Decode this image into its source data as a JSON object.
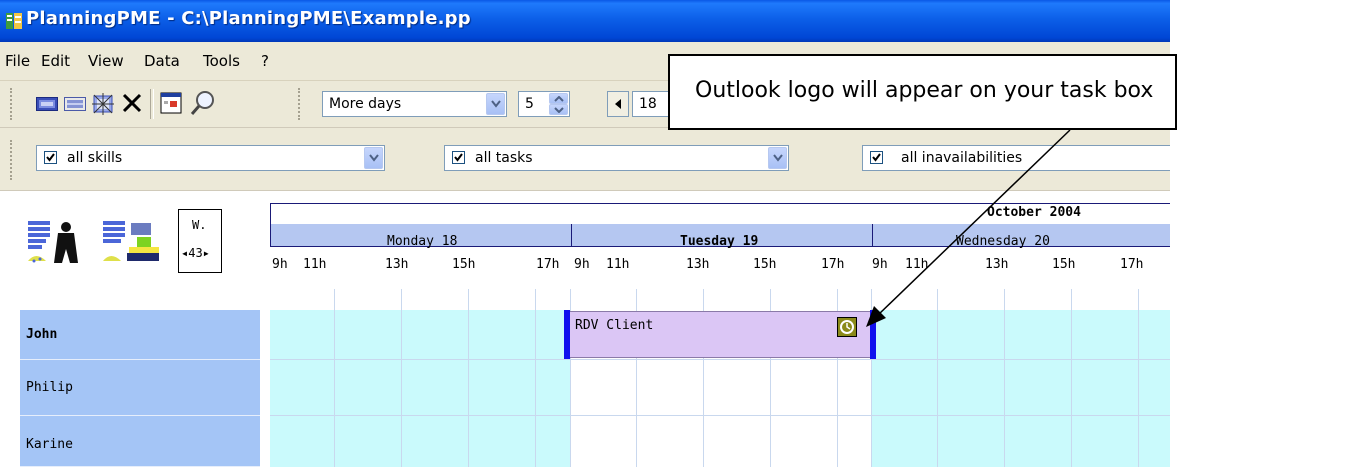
{
  "window": {
    "title": "PlanningPME - C:\\PlanningPME\\Example.pp",
    "title_bar_color": "#0054e3"
  },
  "menu": {
    "items": [
      "File",
      "Edit",
      "View",
      "Data",
      "Tools",
      "?"
    ]
  },
  "toolbar1": {
    "buttons": [
      "view-week-icon",
      "view-day-icon",
      "snowflake-icon",
      "delete-icon",
      "calendar-icon",
      "zoom-icon"
    ],
    "period_select": "More days",
    "count_value": "5",
    "date_partial": "18"
  },
  "filters": {
    "skills": "all skills",
    "tasks": "all tasks",
    "inavailabilities": "all inavailabilities"
  },
  "planning": {
    "week_box": {
      "top": "W.",
      "bottom": "◂43▸"
    },
    "month": "October 2004",
    "days": [
      "Monday 18",
      "Tuesday 19",
      "Wednesday 20"
    ],
    "hours": [
      "9h",
      "11h",
      "13h",
      "15h",
      "17h"
    ],
    "resources": [
      "John",
      "Philip",
      "Karine"
    ],
    "task": {
      "label": "RDV Client",
      "color": "#dbc6f5"
    }
  },
  "callout": {
    "text": "Outlook logo will appear on your task box"
  }
}
